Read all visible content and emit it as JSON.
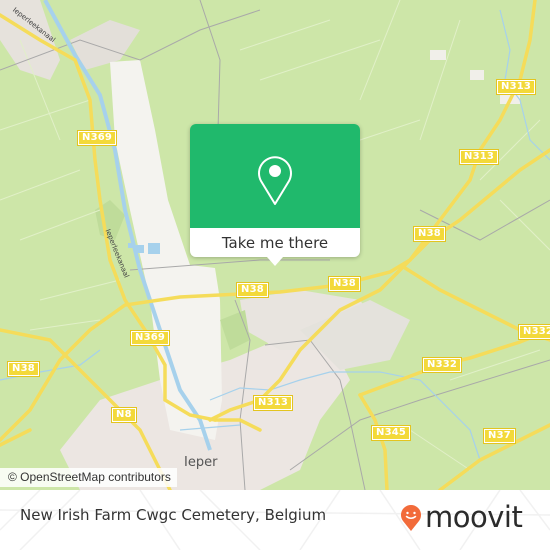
{
  "map": {
    "road_labels": [
      {
        "id": "n369-top",
        "text": "N369"
      },
      {
        "id": "n313-top",
        "text": "N313"
      },
      {
        "id": "n313-mid",
        "text": "N313"
      },
      {
        "id": "n38-right",
        "text": "N38"
      },
      {
        "id": "n38-center",
        "text": "N38"
      },
      {
        "id": "n38-center2",
        "text": "N38"
      },
      {
        "id": "n369-bottom",
        "text": "N369"
      },
      {
        "id": "n332-right",
        "text": "N332"
      },
      {
        "id": "n332-center",
        "text": "N332"
      },
      {
        "id": "n38-left",
        "text": "N38"
      },
      {
        "id": "n313-bottom",
        "text": "N313"
      },
      {
        "id": "n8",
        "text": "N8"
      },
      {
        "id": "n345",
        "text": "N345"
      },
      {
        "id": "n37",
        "text": "N37"
      }
    ],
    "place_labels": {
      "ieper": "Ieper",
      "canal_top": "Ieperleekanaal",
      "canal_mid": "Ieperleekanaal"
    },
    "attribution": "© OpenStreetMap contributors"
  },
  "popup": {
    "icon": "map-pin-icon",
    "button_label": "Take me there",
    "color": "#20b96c"
  },
  "footer": {
    "place_name": "New Irish Farm Cwgc Cemetery, Belgium",
    "logo_text": "moovit",
    "logo_icon": "moovit-smiley-pin-icon",
    "logo_color": "#f26b3a"
  }
}
